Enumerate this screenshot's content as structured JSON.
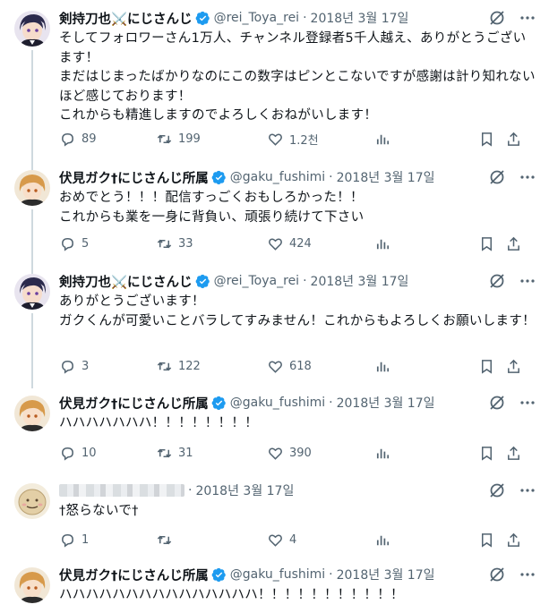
{
  "tweets": [
    {
      "name": "剣持刀也⚔️にじさんじ",
      "verified": true,
      "handle": "@rei_Toya_rei",
      "date": "2018년 3월 17일",
      "text": "そしてフォロワーさん1万人、チャンネル登録者5千人越え、ありがとうございます！\nまだはじまったばかりなのにこの数字はピンとこないですが感謝は計り知れないほど感じております！\nこれからも精進しますのでよろしくおねがいします！",
      "replies": "89",
      "retweets": "199",
      "likes": "1.2천",
      "avatar": "toya"
    },
    {
      "name": "伏見ガク†にじさんじ所属",
      "verified": true,
      "handle": "@gaku_fushimi",
      "date": "2018년 3월 17일",
      "text": "おめでとう！！！配信すっごくおもしろかった！！\nこれからも業を一身に背負い、頑張り続けて下さい",
      "replies": "5",
      "retweets": "33",
      "likes": "424",
      "avatar": "gaku"
    },
    {
      "name": "剣持刀也⚔️にじさんじ",
      "verified": true,
      "handle": "@rei_Toya_rei",
      "date": "2018년 3월 17일",
      "text": "ありがとうございます！\nガクくんが可愛いことバラしてすみません！これからもよろしくお願いします！",
      "replies": "3",
      "retweets": "122",
      "likes": "618",
      "avatar": "toya"
    },
    {
      "name": "伏見ガク†にじさんじ所属",
      "verified": true,
      "handle": "@gaku_fushimi",
      "date": "2018년 3월 17일",
      "text": "ハハハハハハハ！！！！！！！！",
      "replies": "10",
      "retweets": "31",
      "likes": "390",
      "avatar": "gaku"
    },
    {
      "name": "",
      "verified": false,
      "handle": "",
      "date": "2018년 3월 17일",
      "text": "†怒らないで†",
      "replies": "1",
      "retweets": "",
      "likes": "4",
      "avatar": "blob"
    },
    {
      "name": "伏見ガク†にじさんじ所属",
      "verified": true,
      "handle": "@gaku_fushimi",
      "date": "2018년 3월 17일",
      "text": "ハハハハハハハハハハハハハハハ！！！！！！！！！！！",
      "replies": "",
      "retweets": "",
      "likes": "",
      "avatar": "gaku"
    }
  ],
  "colors": {
    "verified": "#1d9bf0",
    "muted": "#536471",
    "text": "#0f1419",
    "line": "#cfd9de"
  }
}
